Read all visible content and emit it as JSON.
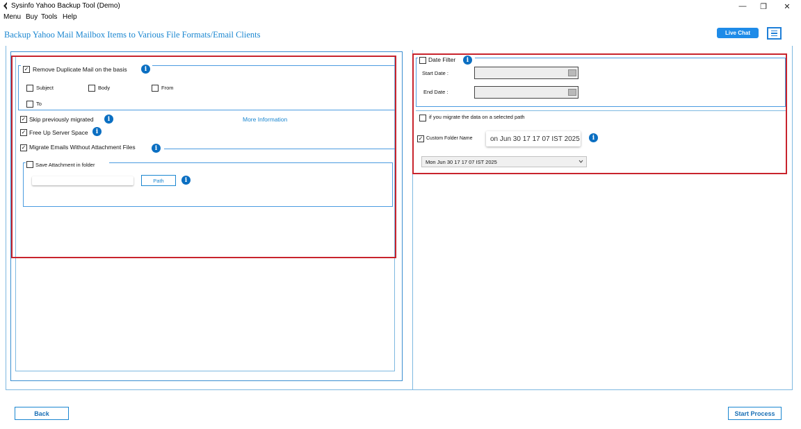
{
  "window": {
    "title": "Sysinfo Yahoo Backup Tool (Demo)",
    "minimize_symbol": "—",
    "maximize_symbol": "❐",
    "close_symbol": "✕"
  },
  "menu": [
    "Menu",
    "Buy",
    "Tools",
    "Help"
  ],
  "header": {
    "title": "Backup Yahoo Mail Mailbox Items to Various File Formats/Email Clients",
    "live_chat": "Live Chat"
  },
  "left": {
    "remove_duplicate": {
      "label": "Remove Duplicate Mail on the basis",
      "checked": true
    },
    "duplicate_options": [
      {
        "label": "Subject",
        "checked": false
      },
      {
        "label": "Body",
        "checked": false
      },
      {
        "label": "From",
        "checked": false
      },
      {
        "label": "To",
        "checked": false
      }
    ],
    "skip_migrated": {
      "label": "Skip previously migrated",
      "checked": true
    },
    "more_information": "More Information",
    "free_up": {
      "label": "Free Up Server Space",
      "checked": true
    },
    "without_attachment": {
      "label": "Migrate Emails Without Attachment Files",
      "checked": true
    },
    "save_attachment": {
      "label": "Save Attachment in folder",
      "checked": false
    },
    "path_button": "Path",
    "path_value": ""
  },
  "right": {
    "date_filter": {
      "label": "Date Filter",
      "checked": false
    },
    "start_date_label": "Start Date :",
    "end_date_label": "End Date :",
    "selected_path": {
      "label": "if you migrate the data on a selected path",
      "checked": false
    },
    "custom_folder": {
      "label": "Custom Folder Name",
      "checked": true
    },
    "folder_name_value": "on Jun 30 17 17 07 IST 2025",
    "folder_select_value": "Mon Jun 30 17 17 07 IST 2025"
  },
  "footer": {
    "back": "Back",
    "start": "Start Process"
  },
  "check_mark": "✓",
  "info_glyph": "i",
  "colors": {
    "accent": "#1a86d0",
    "highlight_red": "#c8232c",
    "info_blue": "#0b6fc2",
    "live_chat_bg": "#1e8be8"
  }
}
